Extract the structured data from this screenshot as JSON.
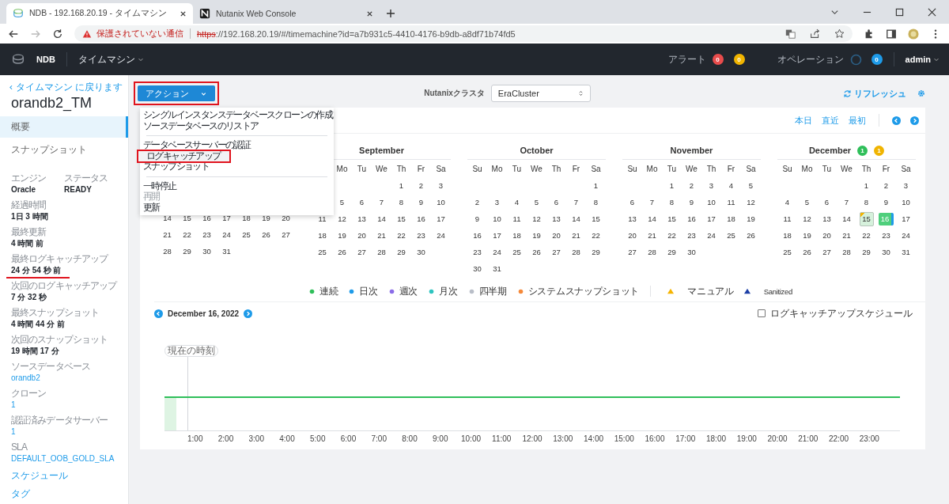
{
  "browser": {
    "tabs": [
      {
        "title": "NDB - 192.168.20.19 - タイムマシン",
        "selected": true,
        "kind": "ndb"
      },
      {
        "title": "Nutanix Web Console",
        "selected": false,
        "kind": "nutanix"
      }
    ],
    "warning": "保護されていない通信",
    "scheme": "https",
    "url": "://192.168.20.19/#/timemachine?id=a7b931c5-4410-4176-b9db-a8df71b74fd5"
  },
  "header": {
    "brand": "NDB",
    "menu": "タイムマシン",
    "alerts_label": "アラート",
    "alert_badges": [
      {
        "count": "0",
        "color": "#e84c4c"
      },
      {
        "count": "0",
        "color": "#f0b400"
      }
    ],
    "operations_label": "オペレーション",
    "operations_count": "0",
    "user": "admin"
  },
  "sidebar": {
    "back_link": "タイムマシン に戻ります",
    "title": "orandb2_TM",
    "nav": [
      {
        "label": "概要",
        "selected": true
      },
      {
        "label": "スナップショット",
        "selected": false
      }
    ],
    "pair": [
      {
        "label": "エンジン",
        "value": "Oracle"
      },
      {
        "label": "ステータス",
        "value": "READY"
      }
    ],
    "fields": [
      {
        "label": "経過時間",
        "value": "1日 3 時間",
        "kind": "text"
      },
      {
        "label": "最終更新",
        "value": "4 時間 前",
        "kind": "text"
      },
      {
        "label": "最終ログキャッチアップ",
        "value": "24 分 54 秒 前",
        "kind": "text",
        "annotated": true
      },
      {
        "label": "次回のログキャッチアップ",
        "value": "7 分 32 秒",
        "kind": "text"
      },
      {
        "label": "最終スナップショット",
        "value": "4 時間 44 分 前",
        "kind": "text"
      },
      {
        "label": "次回のスナップショット",
        "value": "19 時間 17 分",
        "kind": "text"
      },
      {
        "label": "ソースデータベース",
        "value": "orandb2",
        "kind": "link"
      },
      {
        "label": "クローン",
        "value": "1",
        "kind": "link"
      },
      {
        "label": "認証済みデータサーバー",
        "value": "1",
        "kind": "link"
      },
      {
        "label": "SLA",
        "value": "DEFAULT_OOB_GOLD_SLA",
        "kind": "link"
      }
    ],
    "links": [
      "スケジュール",
      "タグ"
    ]
  },
  "toolbar": {
    "action": "アクション",
    "action_annotated": true,
    "cluster_label": "Nutanixクラスタ",
    "cluster": "EraCluster",
    "refresh": "リフレッシュ"
  },
  "action_menu": {
    "groups": [
      [
        {
          "label": "シングルインスタンスデータベースクローンの作成",
          "disabled": false,
          "hovered": false,
          "annotated": false
        },
        {
          "label": "ソースデータベースのリストア",
          "disabled": false,
          "hovered": false,
          "annotated": false
        }
      ],
      [
        {
          "label": "データベースサーバーの認証",
          "disabled": false,
          "hovered": false,
          "annotated": false
        },
        {
          "label": "ログキャッチアップ",
          "disabled": false,
          "hovered": true,
          "annotated": true
        },
        {
          "label": "スナップショット",
          "disabled": false,
          "hovered": false,
          "annotated": false
        }
      ],
      [
        {
          "label": "一時停止",
          "disabled": false,
          "hovered": false,
          "annotated": false
        },
        {
          "label": "再開",
          "disabled": true,
          "hovered": false,
          "annotated": false
        },
        {
          "label": "更新",
          "disabled": false,
          "hovered": false,
          "annotated": false
        }
      ]
    ]
  },
  "calendar": {
    "nav": [
      "本日",
      "直近",
      "最初"
    ],
    "months": [
      {
        "kind": "covered",
        "weeks": [
          {
            "days": [
              "14",
              "15",
              "16",
              "17",
              "18",
              "19",
              "20"
            ]
          },
          {
            "days": [
              "21",
              "22",
              "23",
              "24",
              "25",
              "26",
              "27"
            ]
          },
          {
            "days": [
              "28",
              "29",
              "30",
              "31"
            ]
          }
        ]
      },
      {
        "title": "September",
        "kind": "clipped",
        "weekdays": [
          "Mo",
          "Tu",
          "We",
          "Th",
          "Fr",
          "Sa"
        ],
        "weeks": [
          {
            "days": [
              "1",
              "2",
              "3"
            ],
            "kind": "first"
          },
          {
            "days": [
              "5",
              "6",
              "7",
              "8",
              "9",
              "10"
            ],
            "kind": "first"
          },
          {
            "days": [
              "11",
              "12",
              "13",
              "14",
              "15",
              "16",
              "17"
            ]
          },
          {
            "days": [
              "18",
              "19",
              "20",
              "21",
              "22",
              "23",
              "24"
            ]
          },
          {
            "days": [
              "25",
              "26",
              "27",
              "28",
              "29",
              "30"
            ]
          }
        ]
      },
      {
        "title": "October",
        "kind": "full",
        "weekdays": [
          "Su",
          "Mo",
          "Tu",
          "We",
          "Th",
          "Fr",
          "Sa"
        ],
        "weeks": [
          {
            "days": [
              "1"
            ],
            "kind": "first"
          },
          {
            "days": [
              "2",
              "3",
              "4",
              "5",
              "6",
              "7",
              "8"
            ]
          },
          {
            "days": [
              "9",
              "10",
              "11",
              "12",
              "13",
              "14",
              "15"
            ]
          },
          {
            "days": [
              "16",
              "17",
              "18",
              "19",
              "20",
              "21",
              "22"
            ]
          },
          {
            "days": [
              "23",
              "24",
              "25",
              "26",
              "27",
              "28",
              "29"
            ]
          },
          {
            "days": [
              "30",
              "31"
            ]
          }
        ]
      },
      {
        "title": "November",
        "kind": "full",
        "weekdays": [
          "Su",
          "Mo",
          "Tu",
          "We",
          "Th",
          "Fr",
          "Sa"
        ],
        "weeks": [
          {
            "days": [
              "1",
              "2",
              "3",
              "4",
              "5"
            ],
            "kind": "first"
          },
          {
            "days": [
              "6",
              "7",
              "8",
              "9",
              "10",
              "11",
              "12"
            ]
          },
          {
            "days": [
              "13",
              "14",
              "15",
              "16",
              "17",
              "18",
              "19"
            ]
          },
          {
            "days": [
              "20",
              "21",
              "22",
              "23",
              "24",
              "25",
              "26"
            ]
          },
          {
            "days": [
              "27",
              "28",
              "29",
              "30"
            ]
          }
        ]
      },
      {
        "title": "December",
        "kind": "full",
        "badges": [
          {
            "count": "1",
            "color": "#2fbf5a"
          },
          {
            "count": "1",
            "color": "#f0b400"
          }
        ],
        "weekdays": [
          "Su",
          "Mo",
          "Tu",
          "We",
          "Th",
          "Fr",
          "Sa"
        ],
        "weeks": [
          {
            "days": [
              "1",
              "2",
              "3"
            ],
            "kind": "first"
          },
          {
            "days": [
              "4",
              "5",
              "6",
              "7",
              "8",
              "9",
              "10"
            ]
          },
          {
            "days": [
              "11",
              "12",
              "13",
              "14",
              {
                "label": "15",
                "kind": "manual"
              },
              {
                "label": "16",
                "kind": "selected"
              },
              "17"
            ]
          },
          {
            "days": [
              "18",
              "19",
              "20",
              "21",
              "22",
              "23",
              "24"
            ]
          },
          {
            "days": [
              "25",
              "26",
              "27",
              "28",
              "29",
              "30",
              "31"
            ]
          }
        ]
      }
    ]
  },
  "legend": [
    {
      "label": "連続",
      "color": "#2fbf5a",
      "kind": "dot"
    },
    {
      "label": "日次",
      "color": "#1e9be9",
      "kind": "dot"
    },
    {
      "label": "週次",
      "color": "#8b6de8",
      "kind": "dot"
    },
    {
      "label": "月次",
      "color": "#2ec4c0",
      "kind": "dot"
    },
    {
      "label": "四半期",
      "color": "#b9bec8",
      "kind": "dot"
    },
    {
      "label": "システムスナップショット",
      "color": "#f5893a",
      "kind": "dot"
    },
    {
      "label": "マニュアル",
      "color": "#f5b400",
      "kind": "triangle"
    },
    {
      "label": "Sanitized",
      "color": "#1d3fa6",
      "kind": "triangle"
    }
  ],
  "timeline": {
    "date": "December 16, 2022",
    "schedule_label": "ログキャッチアップスケジュール",
    "schedule_checked": false,
    "now_label": "現在の時刻",
    "hours": [
      "1:00",
      "2:00",
      "3:00",
      "4:00",
      "5:00",
      "6:00",
      "7:00",
      "8:00",
      "9:00",
      "10:00",
      "11:00",
      "12:00",
      "13:00",
      "14:00",
      "15:00",
      "16:00",
      "17:00",
      "18:00",
      "19:00",
      "20:00",
      "21:00",
      "22:00",
      "23:00"
    ]
  }
}
